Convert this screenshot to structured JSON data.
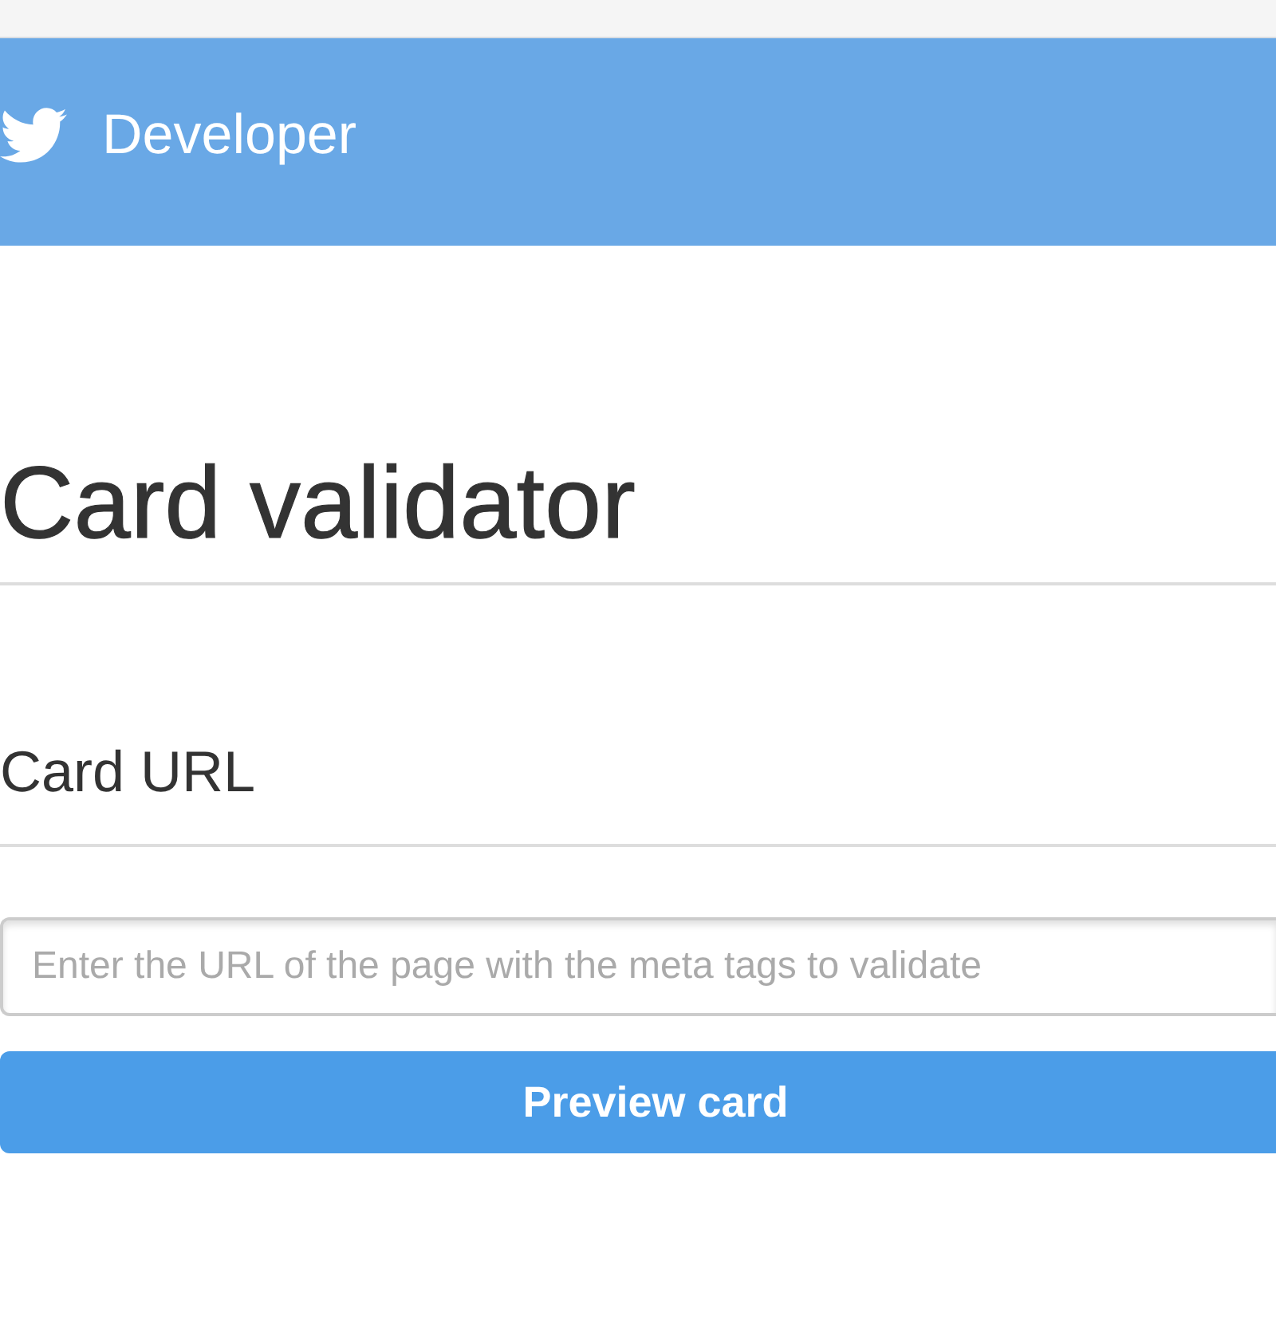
{
  "header": {
    "title": "Developer"
  },
  "page_title": "Card validator",
  "section_title": "Card URL",
  "url_field": {
    "placeholder": "Enter the URL of the page with the meta tags to validate"
  },
  "button": {
    "label": "Preview card"
  }
}
